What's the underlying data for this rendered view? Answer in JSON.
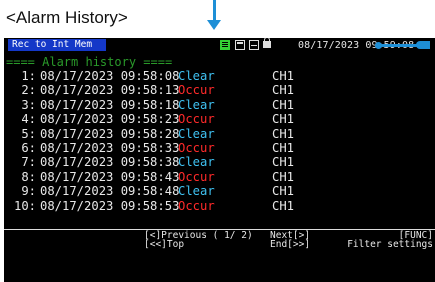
{
  "caption": "<Alarm History>",
  "colors": {
    "accent": "#1e8fd6",
    "clear": "#3fc1f0",
    "occur": "#ff2a2a",
    "title": "#2a9a2a",
    "status_bg": "#1438c8"
  },
  "header": {
    "status": "Rec to Int Mem",
    "datetime": "08/17/2023 09:59:08",
    "icons": [
      "list-view-icon",
      "document-icon",
      "display-icon",
      "lock-icon",
      "usb-connection-icon"
    ]
  },
  "title": "==== Alarm history ====",
  "rows": [
    {
      "idx": "1:",
      "datetime": "08/17/2023 09:58:08",
      "status": "Clear",
      "kind": "clear",
      "channel": "CH1"
    },
    {
      "idx": "2:",
      "datetime": "08/17/2023 09:58:13",
      "status": "Occur",
      "kind": "occur",
      "channel": "CH1"
    },
    {
      "idx": "3:",
      "datetime": "08/17/2023 09:58:18",
      "status": "Clear",
      "kind": "clear",
      "channel": "CH1"
    },
    {
      "idx": "4:",
      "datetime": "08/17/2023 09:58:23",
      "status": "Occur",
      "kind": "occur",
      "channel": "CH1"
    },
    {
      "idx": "5:",
      "datetime": "08/17/2023 09:58:28",
      "status": "Clear",
      "kind": "clear",
      "channel": "CH1"
    },
    {
      "idx": "6:",
      "datetime": "08/17/2023 09:58:33",
      "status": "Occur",
      "kind": "occur",
      "channel": "CH1"
    },
    {
      "idx": "7:",
      "datetime": "08/17/2023 09:58:38",
      "status": "Clear",
      "kind": "clear",
      "channel": "CH1"
    },
    {
      "idx": "8:",
      "datetime": "08/17/2023 09:58:43",
      "status": "Occur",
      "kind": "occur",
      "channel": "CH1"
    },
    {
      "idx": "9:",
      "datetime": "08/17/2023 09:58:48",
      "status": "Clear",
      "kind": "clear",
      "channel": "CH1"
    },
    {
      "idx": "10:",
      "datetime": "08/17/2023 09:58:53",
      "status": "Occur",
      "kind": "occur",
      "channel": "CH1"
    }
  ],
  "footer": {
    "prev": "[<]Previous ( 1/ 2)",
    "top": "[<<]Top",
    "next": "Next[>]",
    "end": "End[>>]",
    "func": "[FUNC]",
    "filter": "Filter settings"
  }
}
